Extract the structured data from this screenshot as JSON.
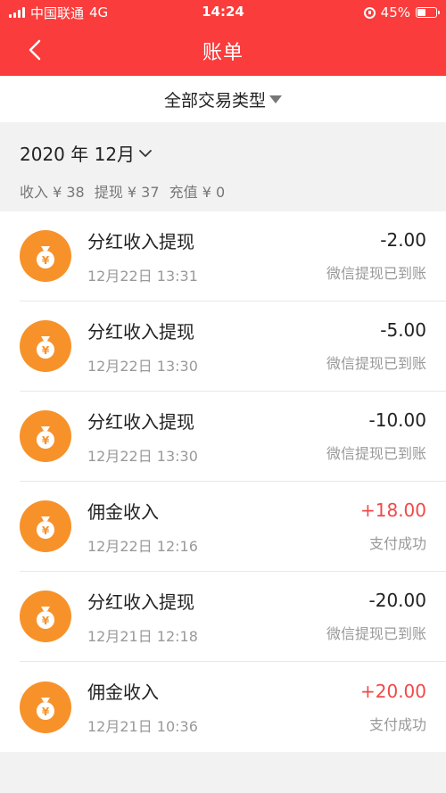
{
  "status_bar": {
    "carrier": "中国联通",
    "network": "4G",
    "time": "14:24",
    "battery": "45%",
    "battery_level": 0.45
  },
  "header": {
    "title": "账单"
  },
  "filter": {
    "label": "全部交易类型"
  },
  "summary": {
    "month": "2020 年 12月",
    "income": "收入 ¥ 38",
    "withdraw": "提现 ¥ 37",
    "recharge": "充值 ¥ 0"
  },
  "transactions": [
    {
      "name": "分红收入提现",
      "date": "12月22日 13:31",
      "amount": "-2.00",
      "status": "微信提现已到账",
      "positive": false
    },
    {
      "name": "分红收入提现",
      "date": "12月22日 13:30",
      "amount": "-5.00",
      "status": "微信提现已到账",
      "positive": false
    },
    {
      "name": "分红收入提现",
      "date": "12月22日 13:30",
      "amount": "-10.00",
      "status": "微信提现已到账",
      "positive": false
    },
    {
      "name": "佣金收入",
      "date": "12月22日 12:16",
      "amount": "+18.00",
      "status": "支付成功",
      "positive": true
    },
    {
      "name": "分红收入提现",
      "date": "12月21日 12:18",
      "amount": "-20.00",
      "status": "微信提现已到账",
      "positive": false
    },
    {
      "name": "佣金收入",
      "date": "12月21日 10:36",
      "amount": "+20.00",
      "status": "支付成功",
      "positive": true
    }
  ],
  "colors": {
    "header_bg": "#fa3c3c",
    "coin": "#f7922a",
    "positive_amount": "#f24848"
  },
  "icons": {
    "back": "chevron-left-icon",
    "coin": "money-bag-icon",
    "month_toggle": "chevron-down-icon",
    "filter_toggle": "triangle-down-icon"
  }
}
